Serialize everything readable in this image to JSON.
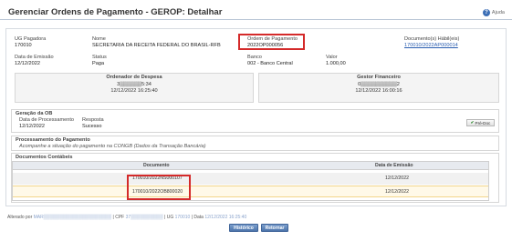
{
  "header": {
    "title": "Gerenciar Ordens de Pagamento - GEROP: Detalhar",
    "help_label": "Ajuda"
  },
  "details": {
    "ug_pagadora": {
      "label": "UG Pagadora",
      "value": "170010"
    },
    "nome": {
      "label": "Nome",
      "value": "SECRETARIA DA RECEITA FEDERAL DO BRASIL-RFB"
    },
    "ordem_pagamento": {
      "label": "Ordem de Pagamento",
      "value": "2022OP000056"
    },
    "documentos_habil": {
      "label": "Documento(s) Hábil(eis)",
      "value": "170010/2022AP000014"
    },
    "data_emissao": {
      "label": "Data de Emissão",
      "value": "12/12/2022"
    },
    "status": {
      "label": "Status",
      "value": "Paga"
    },
    "banco": {
      "label": "Banco",
      "value": "002 - Banco Central"
    },
    "valor": {
      "label": "Valor",
      "value": "1.000,00"
    }
  },
  "ordenador": {
    "title": "Ordenador de Despesa",
    "id_masked": "3▒▒▒▒▒▒5:34",
    "datetime": "12/12/2022 16:25:40"
  },
  "gestor": {
    "title": "Gestor Financeiro",
    "id_masked": "0▒▒▒▒▒▒▒▒▒▒2",
    "datetime": "12/12/2022 16:00:16"
  },
  "geracao_ob": {
    "title": "Geração da OB",
    "data_label": "Data de Processamento",
    "data_value": "12/12/2022",
    "resposta_label": "Resposta",
    "resposta_value": "Sucesso",
    "button_label": "Pré-Doc"
  },
  "processamento": {
    "title": "Processamento do Pagamento",
    "description": "Acompanhe a situação do pagamento na CONGB (Dados da Transação Bancária)"
  },
  "documentos_contabeis": {
    "title": "Documentos Contábeis",
    "columns": [
      "Documento",
      "Data de Emissão"
    ],
    "rows": [
      {
        "documento": "170010/2022NS000107",
        "data": "12/12/2022"
      },
      {
        "documento": "170010/2022OB800020",
        "data": "12/12/2022"
      }
    ]
  },
  "footer": {
    "alterado_label": "Alterado por",
    "alterado_value": "MAR▒▒▒▒▒▒▒▒▒▒▒▒▒▒▒▒▒▒▒▒▒",
    "cpf_label": "| CPF",
    "cpf_value": "37▒▒▒▒▒▒▒▒▒▒",
    "ug_label": "| UG",
    "ug_value": "170010",
    "data_label": "| Data",
    "data_value": "12/12/2022 16:25:40"
  },
  "actions": {
    "historico": "Histórico",
    "retornar": "Retornar"
  },
  "colors": {
    "highlight_border": "#d42a2a",
    "button_blue": "#4c74ab",
    "link": "#2a5db0"
  }
}
